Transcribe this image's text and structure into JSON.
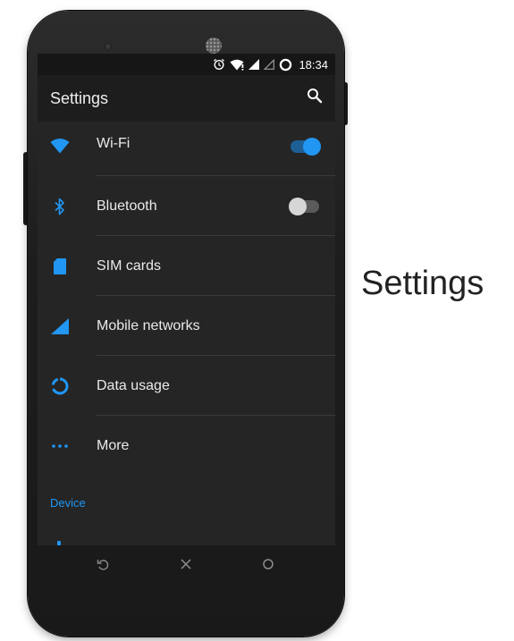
{
  "status_bar": {
    "time": "18:34",
    "icons": [
      "alarm-icon",
      "wifi-signal-icon",
      "cell-signal-icon",
      "cell-signal-empty-icon",
      "battery-ring-icon"
    ]
  },
  "app_bar": {
    "title": "Settings",
    "search_icon": "search-icon"
  },
  "settings_items": [
    {
      "label": "Wi-Fi",
      "icon": "wifi-icon",
      "toggle": true
    },
    {
      "label": "Bluetooth",
      "icon": "bluetooth-icon",
      "toggle": false
    },
    {
      "label": "SIM cards",
      "icon": "sim-card-icon"
    },
    {
      "label": "Mobile networks",
      "icon": "signal-icon"
    },
    {
      "label": "Data usage",
      "icon": "data-usage-icon"
    },
    {
      "label": "More",
      "icon": "more-dots-icon"
    }
  ],
  "section_header": "Device",
  "nav_bar": [
    "back-icon",
    "close-icon",
    "home-circle-icon"
  ],
  "caption": "Settings",
  "colors": {
    "accent": "#2196f3",
    "screen_bg": "#252525",
    "appbar_bg": "#1d1d1d",
    "statusbar_bg": "#161616"
  }
}
